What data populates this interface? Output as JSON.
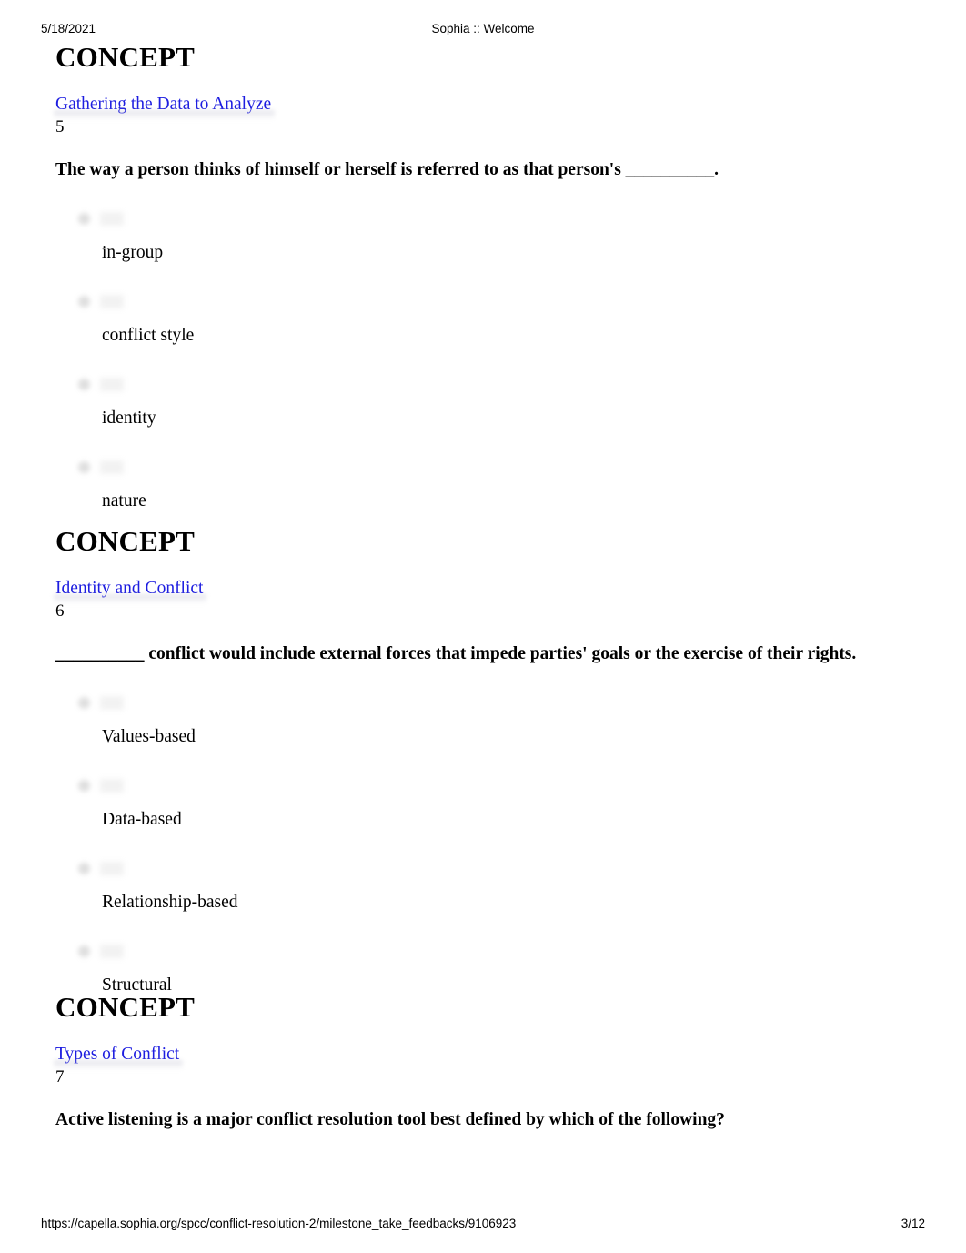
{
  "header": {
    "date": "5/18/2021",
    "title": "Sophia :: Welcome"
  },
  "footer": {
    "url": "https://capella.sophia.org/spcc/conflict-resolution-2/milestone_take_feedbacks/9106923",
    "page": "3/12"
  },
  "colors": {
    "link": "#1d1de0",
    "text": "#000000",
    "background": "#ffffff"
  },
  "concepts": [
    {
      "heading": "CONCEPT",
      "link": "Gathering the Data to Analyze",
      "number": "5",
      "question": "The way a person thinks of himself or herself is referred to as that person's __________.",
      "answers": [
        "in-group",
        "conflict style",
        "identity",
        "nature"
      ]
    },
    {
      "heading": "CONCEPT",
      "link": "Identity and Conflict",
      "number": "6",
      "question": "__________ conflict would include external forces that impede parties' goals or the exercise of their rights.",
      "answers": [
        "Values-based",
        "Data-based",
        "Relationship-based",
        "Structural"
      ]
    },
    {
      "heading": "CONCEPT",
      "link": "Types of Conflict",
      "number": "7",
      "question": "Active listening is a major conflict resolution tool best defined by which of the following?",
      "answers": []
    }
  ]
}
